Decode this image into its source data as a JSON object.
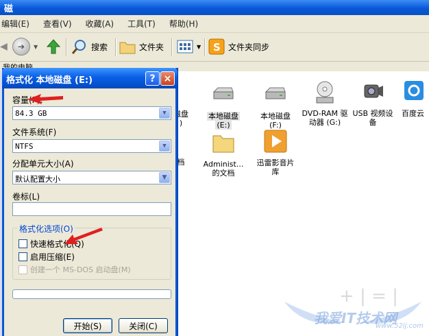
{
  "window": {
    "title": "磁"
  },
  "menu": [
    "编辑(E)",
    "查看(V)",
    "收藏(A)",
    "工具(T)",
    "帮助(H)"
  ],
  "toolbar": {
    "search": "搜索",
    "folders": "文件夹",
    "sync": "文件夹同步"
  },
  "address": {
    "label": "我的电脑"
  },
  "items": [
    {
      "label": "磁盘",
      "sub": ")"
    },
    {
      "label": "本地磁盘",
      "sub": "(E:)"
    },
    {
      "label": "本地磁盘",
      "sub": "(F:)"
    },
    {
      "label": "DVD-RAM 驱",
      "sub": "动器 (G:)"
    },
    {
      "label": "USB 视频设",
      "sub": "备"
    },
    {
      "label": "百度云"
    },
    {
      "label": "档"
    },
    {
      "label": "Administ...",
      "sub": "的文档"
    },
    {
      "label": "迅雷影音片",
      "sub": "库"
    }
  ],
  "dialog": {
    "title": "格式化 本地磁盘 (E:)",
    "help": "?",
    "close": "×",
    "capacity_label": "容量(P):",
    "capacity_value": "84.3 GB",
    "fs_label": "文件系统(F)",
    "fs_value": "NTFS",
    "alloc_label": "分配单元大小(A)",
    "alloc_value": "默认配置大小",
    "volume_label": "卷标(L)",
    "volume_value": "",
    "options_label": "格式化选项(O)",
    "quick_format": "快速格式化(Q)",
    "compress": "启用压缩(E)",
    "msdos": "创建一个 MS-DOS 启动盘(M)",
    "start": "开始(S)",
    "close_btn": "关闭(C)",
    "progress": 0
  },
  "watermark": {
    "text": "我爱IT技术网",
    "url": "www.52ij.com"
  }
}
